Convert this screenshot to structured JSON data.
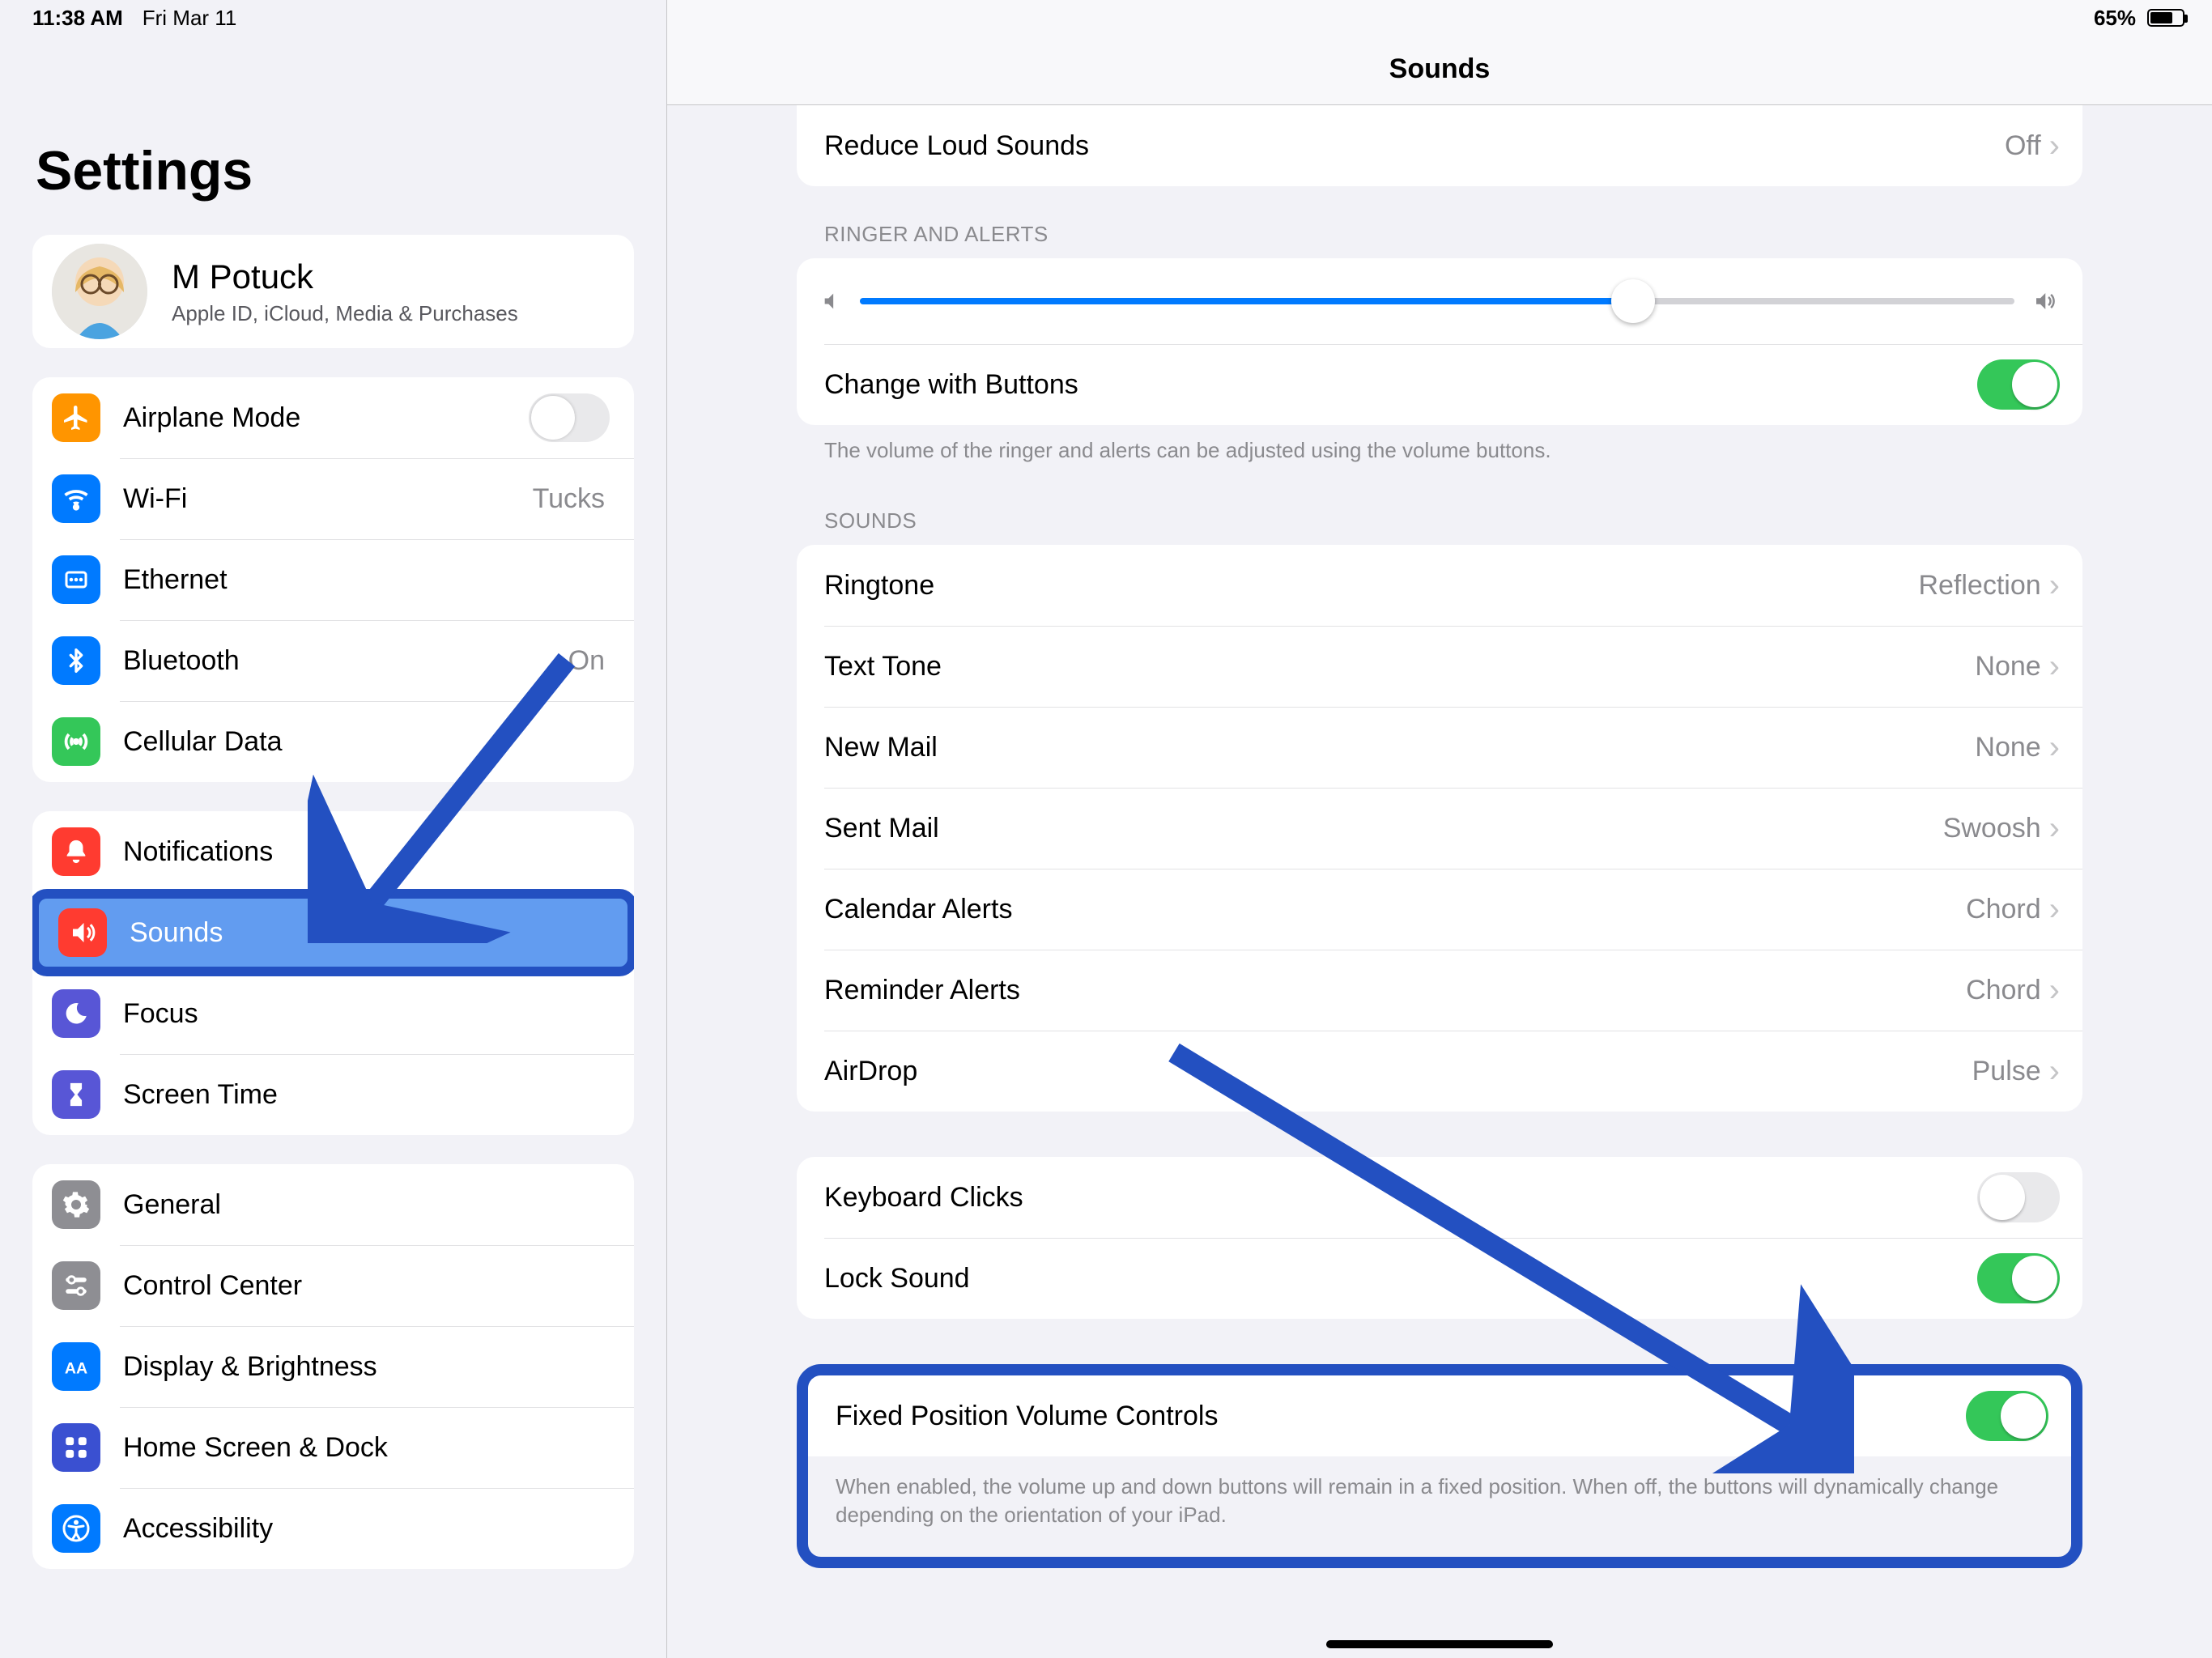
{
  "status": {
    "time": "11:38 AM",
    "date": "Fri Mar 11",
    "battery": "65%"
  },
  "sidebar": {
    "title": "Settings",
    "profile": {
      "name": "M Potuck",
      "sub": "Apple ID, iCloud, Media & Purchases"
    },
    "group1": {
      "airplane": "Airplane Mode",
      "wifi": "Wi-Fi",
      "wifi_val": "Tucks",
      "ethernet": "Ethernet",
      "bluetooth": "Bluetooth",
      "bluetooth_val": "On",
      "cellular": "Cellular Data"
    },
    "group2": {
      "notifications": "Notifications",
      "sounds": "Sounds",
      "focus": "Focus",
      "screen_time": "Screen Time"
    },
    "group3": {
      "general": "General",
      "control_center": "Control Center",
      "display": "Display & Brightness",
      "home_screen": "Home Screen & Dock",
      "accessibility": "Accessibility"
    }
  },
  "main": {
    "title": "Sounds",
    "reduce_loud": {
      "label": "Reduce Loud Sounds",
      "value": "Off"
    },
    "ringer_header": "RINGER AND ALERTS",
    "ringer_slider_pct": 67,
    "change_buttons": "Change with Buttons",
    "ringer_footer": "The volume of the ringer and alerts can be adjusted using the volume buttons.",
    "sounds_header": "SOUNDS",
    "sounds_rows": [
      {
        "label": "Ringtone",
        "value": "Reflection"
      },
      {
        "label": "Text Tone",
        "value": "None"
      },
      {
        "label": "New Mail",
        "value": "None"
      },
      {
        "label": "Sent Mail",
        "value": "Swoosh"
      },
      {
        "label": "Calendar Alerts",
        "value": "Chord"
      },
      {
        "label": "Reminder Alerts",
        "value": "Chord"
      },
      {
        "label": "AirDrop",
        "value": "Pulse"
      }
    ],
    "keyboard_clicks": "Keyboard Clicks",
    "lock_sound": "Lock Sound",
    "fixed_pos": {
      "label": "Fixed Position Volume Controls",
      "footer": "When enabled, the volume up and down buttons will remain in a fixed position. When off, the buttons will dynamically change depending on the orientation of your iPad."
    }
  }
}
